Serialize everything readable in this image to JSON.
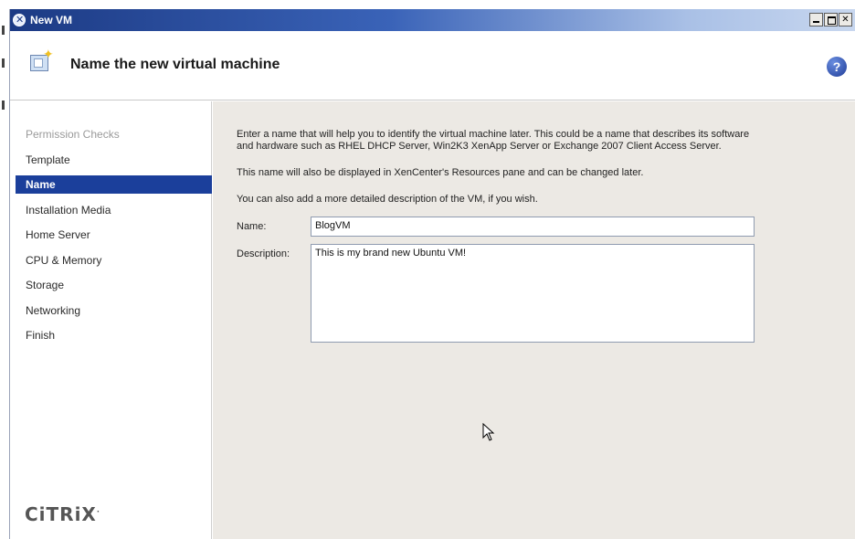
{
  "window": {
    "title": "New VM",
    "buttons": [
      "minimize",
      "maximize",
      "close"
    ]
  },
  "header": {
    "title": "Name the new virtual machine",
    "help_label": "?"
  },
  "nav": {
    "items": [
      {
        "label": "Permission Checks",
        "state": "disabled"
      },
      {
        "label": "Template",
        "state": "normal"
      },
      {
        "label": "Name",
        "state": "active"
      },
      {
        "label": "Installation Media",
        "state": "normal"
      },
      {
        "label": "Home Server",
        "state": "normal"
      },
      {
        "label": "CPU & Memory",
        "state": "normal"
      },
      {
        "label": "Storage",
        "state": "normal"
      },
      {
        "label": "Networking",
        "state": "normal"
      },
      {
        "label": "Finish",
        "state": "normal"
      }
    ],
    "brand": "CiTRiX"
  },
  "content": {
    "intro_line1": "Enter a name that will help you to identify the virtual machine later. This could be a name that describes its software",
    "intro_line2": "and hardware such as RHEL DHCP Server, Win2K3 XenApp Server or Exchange 2007 Client Access Server.",
    "display_note": "This name will also be displayed in XenCenter's Resources pane and can be changed later.",
    "description_note": "You can also add a more detailed description of the VM, if you wish.",
    "name_label": "Name:",
    "name_value": "BlogVM",
    "description_label": "Description:",
    "description_value": "This is my brand new Ubuntu VM!"
  },
  "colors": {
    "active_nav": "#1b3f9b",
    "content_bg": "#ece9e4",
    "titlebar_start": "#1c3a84"
  }
}
